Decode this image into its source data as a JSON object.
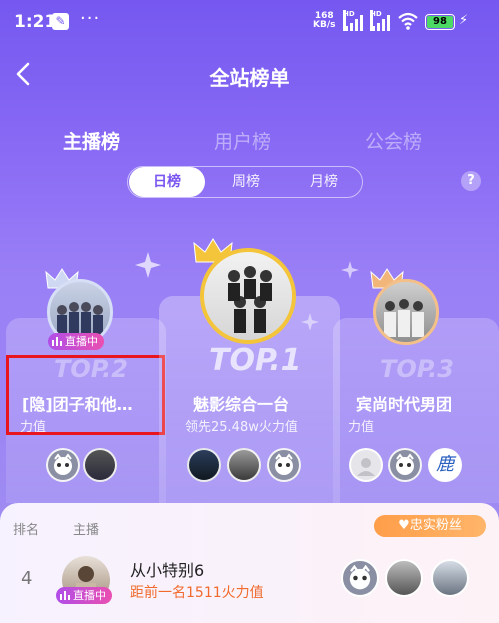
{
  "status_bar": {
    "time": "1:21",
    "dots": "···",
    "speed_top": "168",
    "speed_bottom": "KB/s",
    "hd1": "HD",
    "hd2": "HD",
    "battery": "98",
    "battery_color": "#4cd964"
  },
  "nav": {
    "title": "全站榜单",
    "back_icon": "chevron-left-icon"
  },
  "tabs": [
    {
      "label": "主播榜",
      "active": true
    },
    {
      "label": "用户榜",
      "active": false
    },
    {
      "label": "公会榜",
      "active": false
    }
  ],
  "period": {
    "options": [
      "日榜",
      "周榜",
      "月榜"
    ],
    "selected": "日榜"
  },
  "help_icon": "?",
  "podium": {
    "second": {
      "rank_label": "TOP.2",
      "name": "[隐]团子和他…",
      "sub": "力值",
      "live_badge": "直播中"
    },
    "first": {
      "rank_label": "TOP.1",
      "name": "魅影综合一台",
      "sub": "领先25.48w火力值"
    },
    "third": {
      "rank_label": "TOP.3",
      "name": "宾尚时代男团",
      "sub": "力值",
      "fan_logo_text": "鹿"
    }
  },
  "list": {
    "header_rank": "排名",
    "header_host": "主播",
    "loyal_fans_label": "忠实粉丝",
    "rows": [
      {
        "rank": "4",
        "name": "从小特别6",
        "sub": "距前一名1511火力值",
        "live_badge": "直播中"
      }
    ]
  },
  "colors": {
    "accent": "#7558f0",
    "highlight": "#e8141e",
    "orange": "#f06a2c",
    "gold": "#f4c53a"
  }
}
